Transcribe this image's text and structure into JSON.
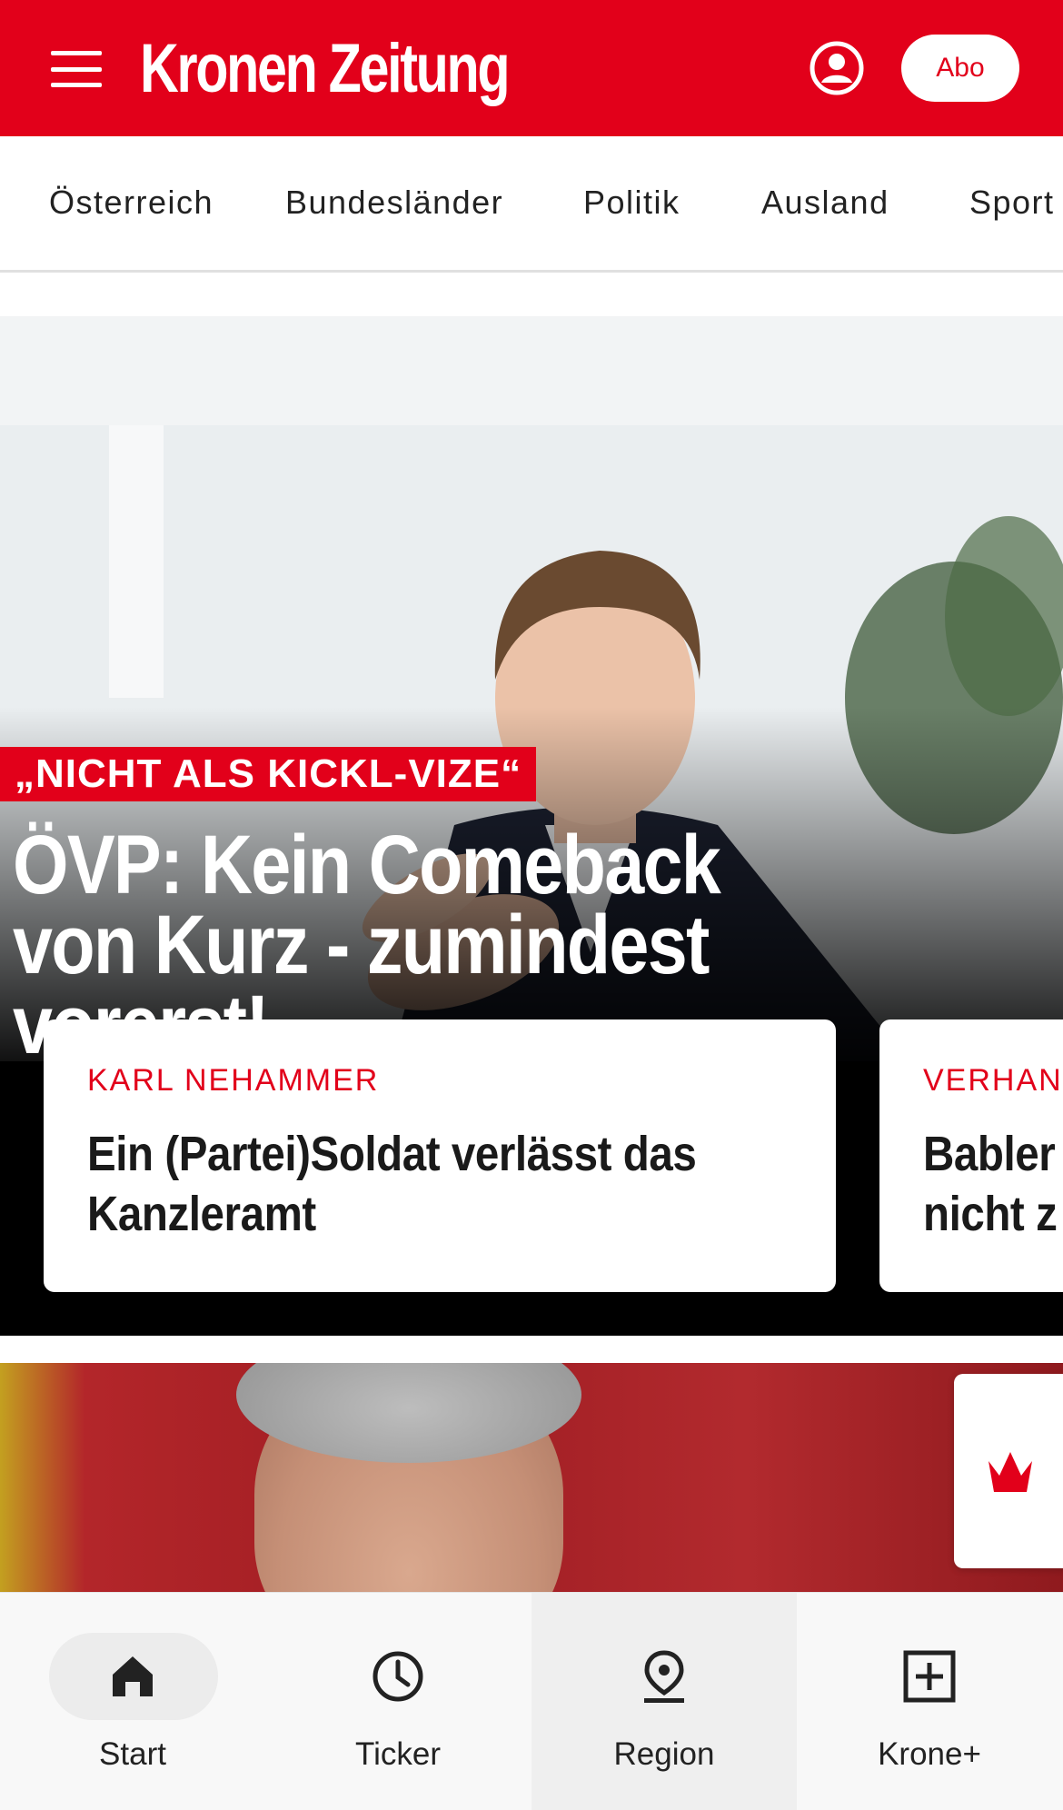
{
  "header": {
    "logo": "Kronen Zeitung",
    "abo_label": "Abo",
    "brand_color": "#e2001a"
  },
  "categories": [
    "Österreich",
    "Bundesländer",
    "Politik",
    "Ausland",
    "Sport"
  ],
  "hero": {
    "kicker": "„NICHT ALS KICKL-VIZE“",
    "headline": "ÖVP: Kein Comeback von Kurz - zumindest vorerst!",
    "teasers": [
      {
        "kicker": "KARL NEHAMMER",
        "title": "Ein (Partei)Soldat verlässt das Kanzleramt"
      },
      {
        "kicker": "VERHANI",
        "title": "Babler nicht z"
      }
    ]
  },
  "bottom_nav": {
    "items": [
      {
        "label": "Start",
        "icon": "home-icon"
      },
      {
        "label": "Ticker",
        "icon": "clock-icon"
      },
      {
        "label": "Region",
        "icon": "location-pin-icon"
      },
      {
        "label": "Krone+",
        "icon": "plus-box-icon"
      }
    ]
  }
}
